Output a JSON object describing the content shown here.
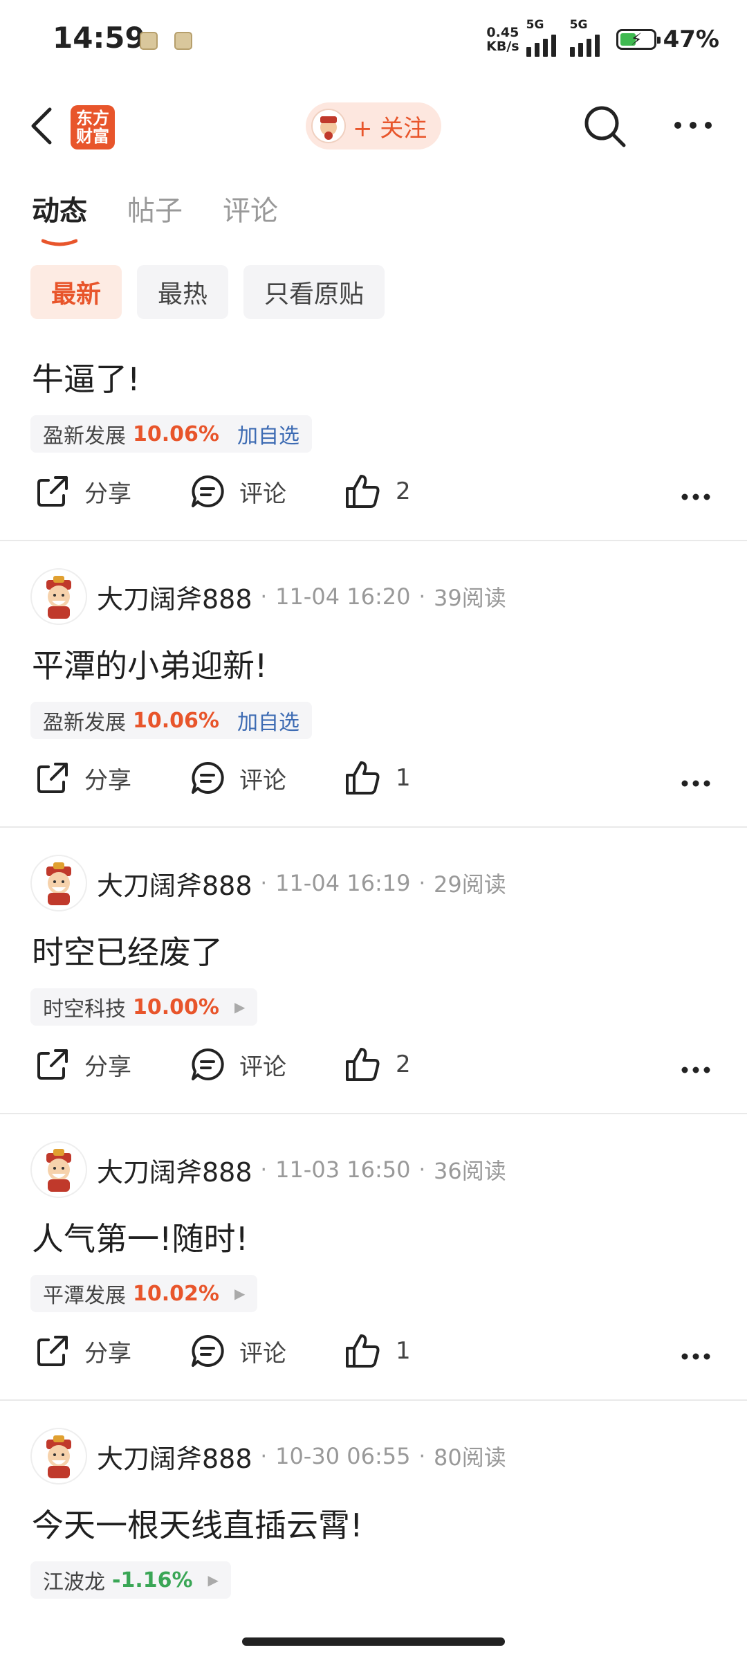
{
  "status": {
    "time": "14:59",
    "net_speed": "0.45",
    "net_unit": "KB/s",
    "sig1": "5G",
    "sig2": "5G",
    "battery": "47%",
    "battery_level": 0.47
  },
  "header": {
    "logo_line1": "东方",
    "logo_line2": "财富",
    "follow_label": "+ 关注"
  },
  "tabs": [
    "动态",
    "帖子",
    "评论"
  ],
  "filters": [
    "最新",
    "最热",
    "只看原贴"
  ],
  "actions": {
    "share": "分享",
    "comment": "评论"
  },
  "posts": [
    {
      "content": "牛逼了!",
      "stock": {
        "name": "盈新发展",
        "pct": "10.06%",
        "dir": "up",
        "add": "加自选"
      },
      "likes": "2"
    },
    {
      "author": "大刀阔斧888",
      "time": "11-04 16:20",
      "reads": "39阅读",
      "content": "平潭的小弟迎新!",
      "stock": {
        "name": "盈新发展",
        "pct": "10.06%",
        "dir": "up",
        "add": "加自选"
      },
      "likes": "1"
    },
    {
      "author": "大刀阔斧888",
      "time": "11-04 16:19",
      "reads": "29阅读",
      "content": "时空已经废了",
      "stock": {
        "name": "时空科技",
        "pct": "10.00%",
        "dir": "up"
      },
      "likes": "2"
    },
    {
      "author": "大刀阔斧888",
      "time": "11-03 16:50",
      "reads": "36阅读",
      "content": "人气第一!随时!",
      "stock": {
        "name": "平潭发展",
        "pct": "10.02%",
        "dir": "up"
      },
      "likes": "1"
    },
    {
      "author": "大刀阔斧888",
      "time": "10-30 06:55",
      "reads": "80阅读",
      "content": "今天一根天线直插云霄!",
      "stock": {
        "name": "江波龙",
        "pct": "-1.16%",
        "dir": "down"
      }
    }
  ]
}
